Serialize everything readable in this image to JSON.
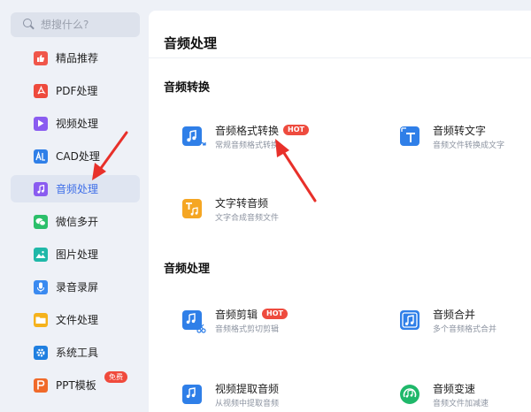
{
  "search": {
    "placeholder": "想搜什么?"
  },
  "sidebar": {
    "items": [
      {
        "label": "精品推荐",
        "color": "#f0564a",
        "active": false
      },
      {
        "label": "PDF处理",
        "color": "#ee4a3d",
        "active": false
      },
      {
        "label": "视频处理",
        "color": "#8a5cf0",
        "active": false
      },
      {
        "label": "CAD处理",
        "color": "#2f7fe8",
        "active": false
      },
      {
        "label": "音频处理",
        "color": "#8a5cf0",
        "active": true
      },
      {
        "label": "微信多开",
        "color": "#2bbf6a",
        "active": false
      },
      {
        "label": "图片处理",
        "color": "#1fb8a8",
        "active": false
      },
      {
        "label": "录音录屏",
        "color": "#3a8af0",
        "active": false
      },
      {
        "label": "文件处理",
        "color": "#f5b21c",
        "active": false
      },
      {
        "label": "系统工具",
        "color": "#1f7fe0",
        "active": false
      },
      {
        "label": "PPT模板",
        "color": "#f06a2a",
        "active": false,
        "badge": "免费"
      }
    ]
  },
  "main": {
    "title": "音频处理",
    "sections": [
      {
        "title": "音频转换",
        "tools": [
          {
            "name": "音频格式转换",
            "desc": "常规音频格式转换",
            "hot": "HOT",
            "color": "#2f7fe8"
          },
          {
            "name": "音频转文字",
            "desc": "音频文件转换成文字",
            "color": "#2f7fe8"
          },
          {
            "name": "文字转音频",
            "desc": "文字合成音频文件",
            "color": "#f5a623"
          }
        ]
      },
      {
        "title": "音频处理",
        "tools": [
          {
            "name": "音频剪辑",
            "desc": "音频格式剪切剪辑",
            "hot": "HOT",
            "color": "#2f7fe8"
          },
          {
            "name": "音频合并",
            "desc": "多个音频格式合并",
            "color": "#2f7fe8"
          },
          {
            "name": "视频提取音频",
            "desc": "从视频中提取音频",
            "color": "#2f7fe8"
          },
          {
            "name": "音频变速",
            "desc": "音频文件加减速",
            "color": "#1fb86a"
          }
        ]
      }
    ]
  },
  "annotation": {
    "arrow_color": "#e8302a"
  }
}
